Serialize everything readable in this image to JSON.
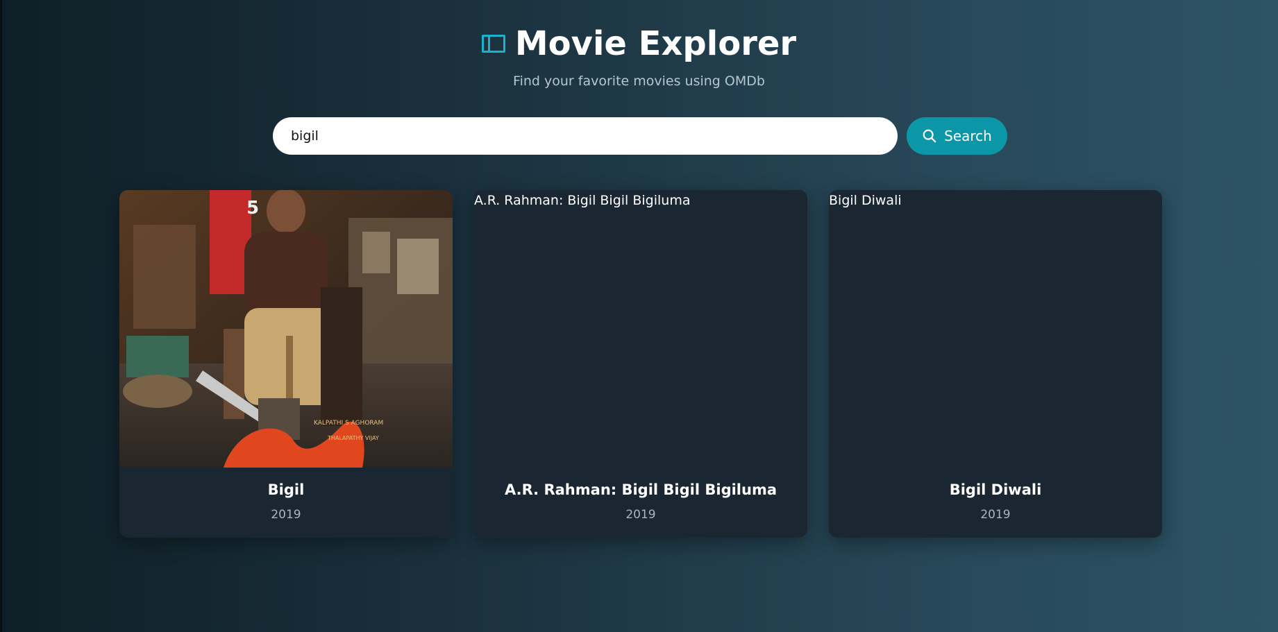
{
  "header": {
    "logo_icon": "film-frame-icon",
    "title": "Movie Explorer",
    "subtitle": "Find your favorite movies using OMDb"
  },
  "search": {
    "value": "bigil",
    "button_label": "Search",
    "button_icon": "search-icon"
  },
  "colors": {
    "accent": "#1ab2cf",
    "button": "#0b97a8",
    "card": "#1a2733"
  },
  "results": [
    {
      "title": "Bigil",
      "year": "2019",
      "poster": "image",
      "poster_alt": ""
    },
    {
      "title": "A.R. Rahman: Bigil Bigil Bigiluma",
      "year": "2019",
      "poster": "missing",
      "poster_alt": "A.R. Rahman: Bigil Bigil Bigiluma"
    },
    {
      "title": "Bigil Diwali",
      "year": "2019",
      "poster": "missing",
      "poster_alt": "Bigil Diwali"
    }
  ]
}
